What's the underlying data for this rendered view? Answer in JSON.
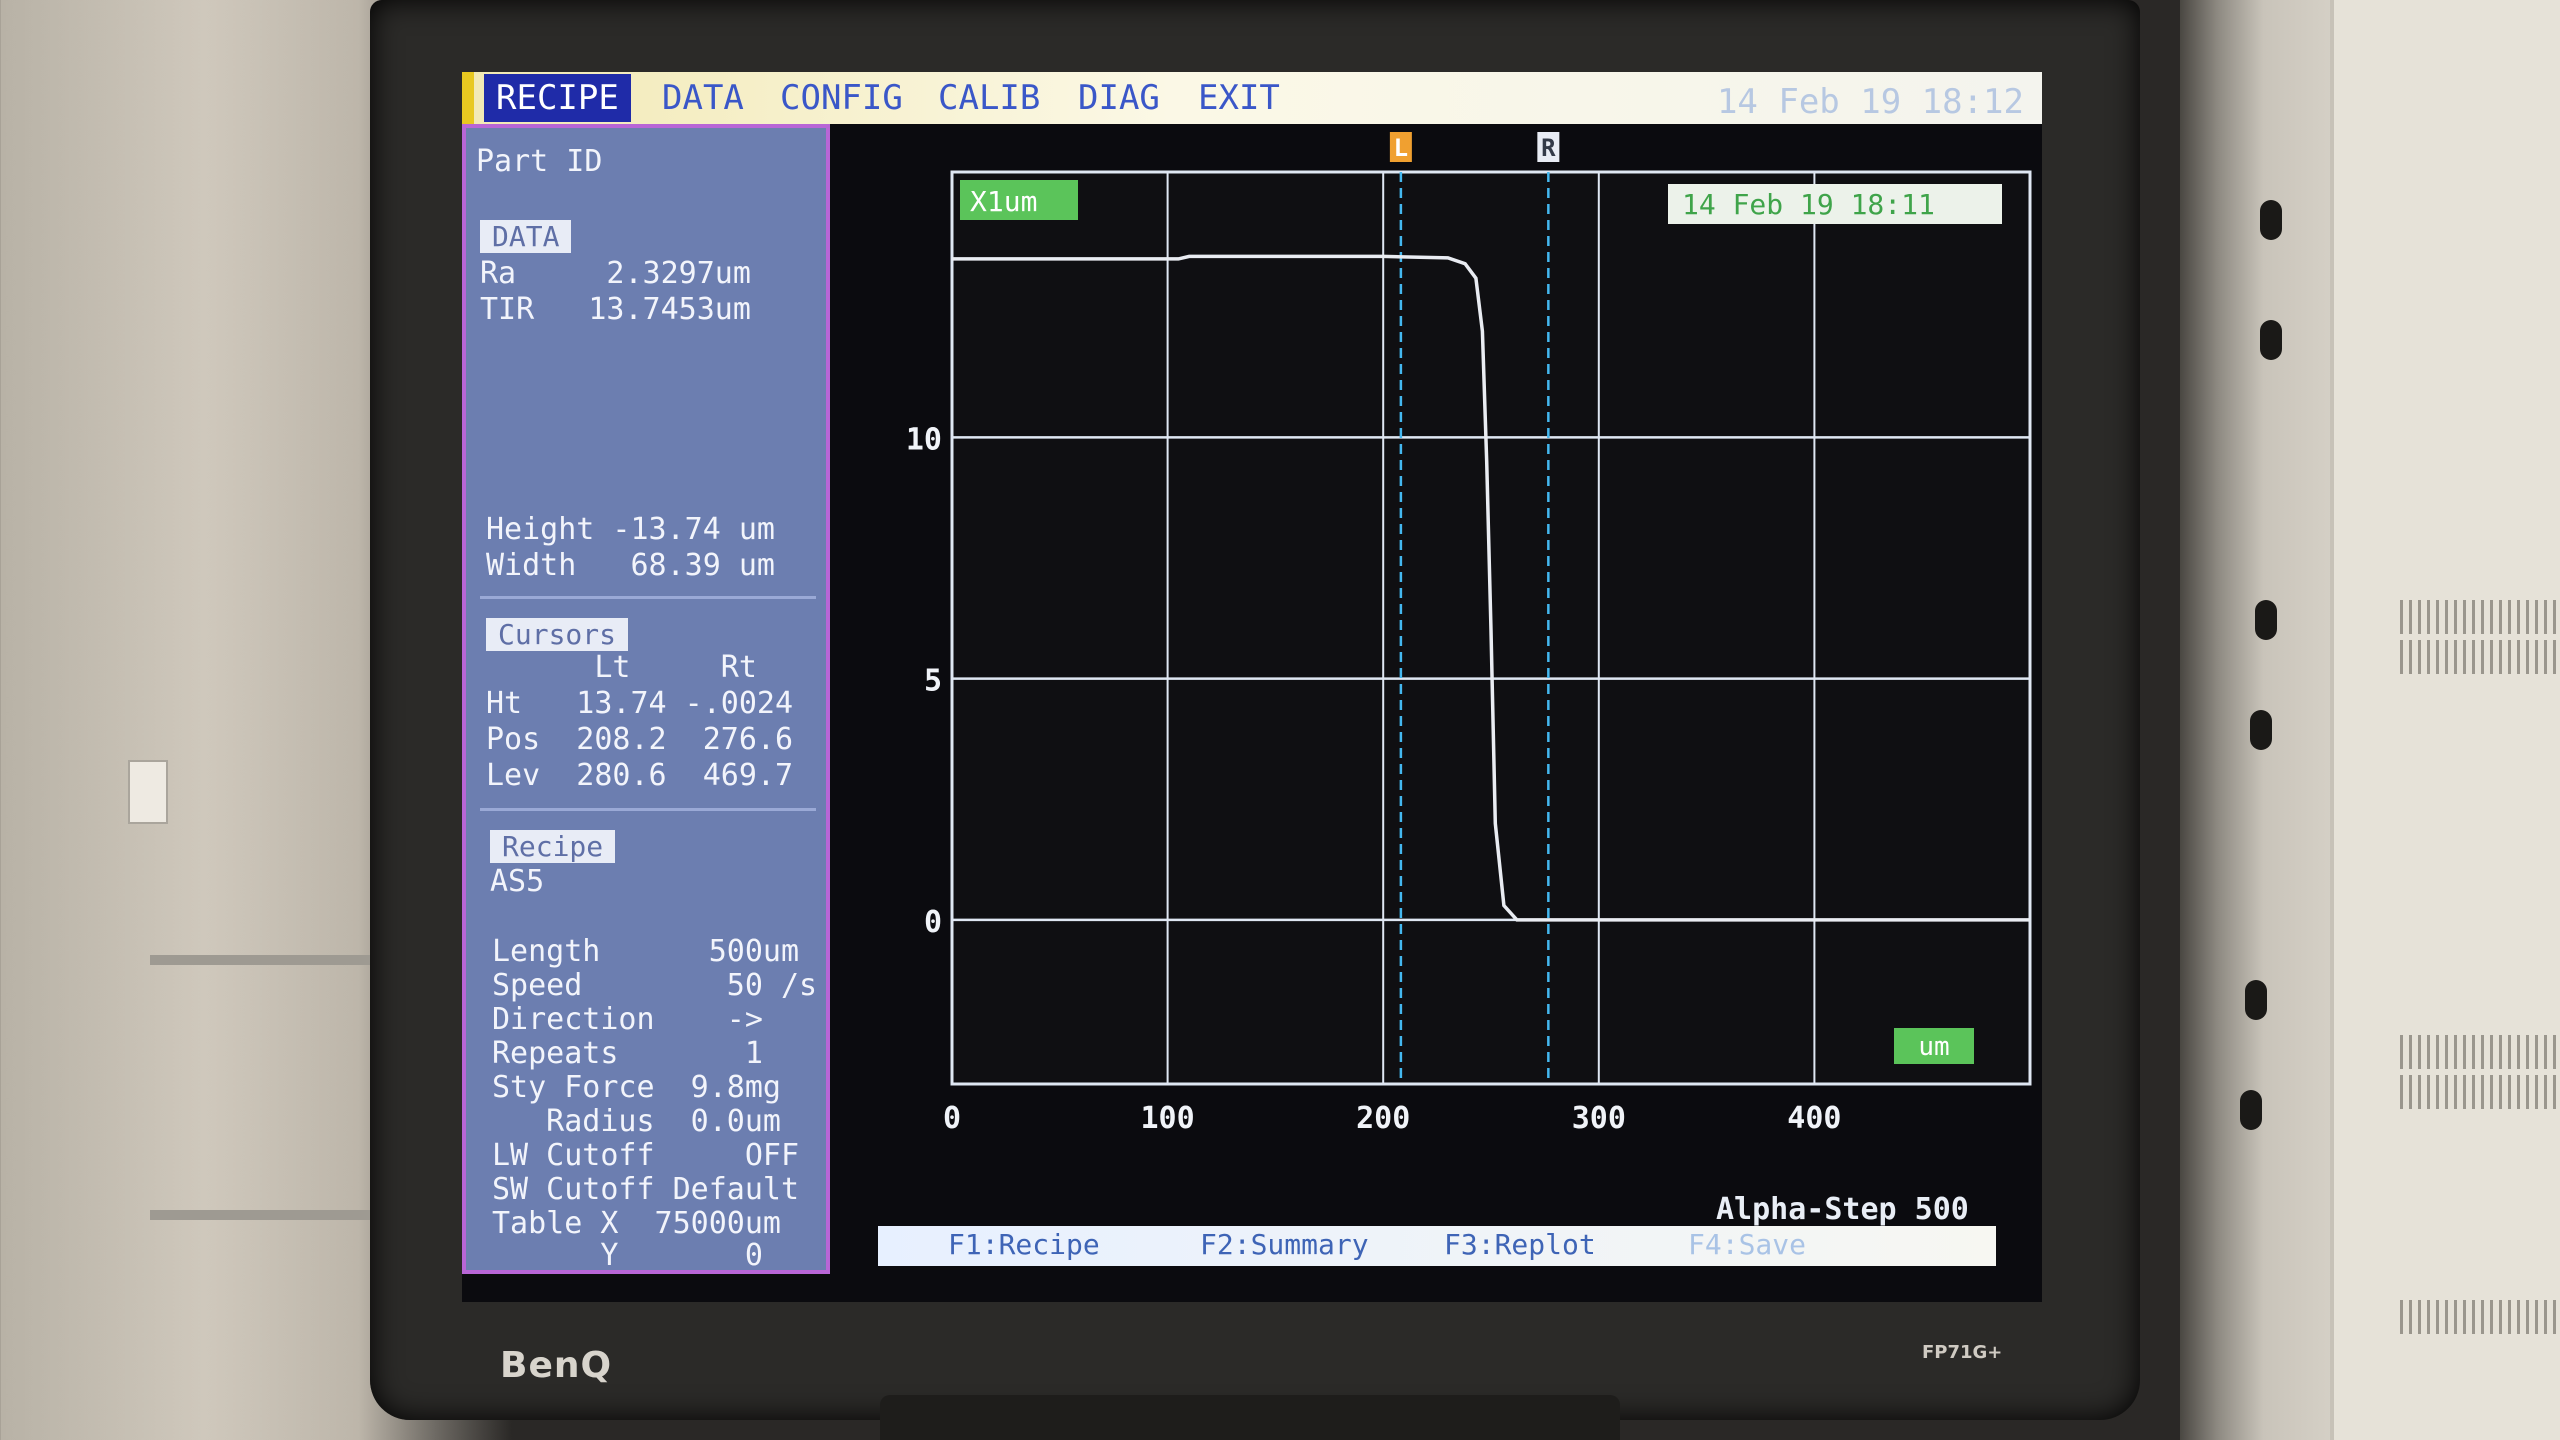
{
  "menu": {
    "items": [
      "RECIPE",
      "DATA",
      "CONFIG",
      "CALIB",
      "DIAG",
      "EXIT"
    ],
    "active": "RECIPE",
    "datetime": "14 Feb 19 18:12"
  },
  "left_panel": {
    "part_id_label": "Part ID",
    "data_tag": "DATA",
    "ra": "Ra     2.3297um",
    "tir": "TIR   13.7453um",
    "height": "Height -13.74 um",
    "width": "Width   68.39 um",
    "cursors_tag": "Cursors",
    "cursor_header": "      Lt     Rt",
    "cursor_ht": "Ht   13.74 -.0024",
    "cursor_pos": "Pos  208.2  276.6",
    "cursor_lev": "Lev  280.6  469.7",
    "recipe_tag": "Recipe",
    "recipe_name": "AS5",
    "length": "Length      500um",
    "speed": "Speed        50 /s",
    "direction": "Direction    ->",
    "repeats": "Repeats       1",
    "sty_force": "Sty Force  9.8mg",
    "radius": "   Radius  0.0um",
    "lw_cutoff": "LW Cutoff     OFF",
    "sw_cutoff": "SW Cutoff Default",
    "table_x": "Table X  75000um",
    "table_y": "      Y       0"
  },
  "plot": {
    "scale_tag": "X1um",
    "date_tag": "14 Feb 19 18:11",
    "unit_tag": "um",
    "cursor_left_label": "L",
    "cursor_right_label": "R",
    "brand": "Alpha-Step 500",
    "colors": {
      "trace": "#e9ecf2",
      "grid": "#dfe7f3",
      "cursor": "#44b8f0",
      "tag_bg": "#5bc45a"
    }
  },
  "fkeys": [
    "F1:Recipe",
    "F2:Summary",
    "F3:Replot",
    "F4:Save"
  ],
  "monitor": {
    "brand": "BenQ",
    "model": "FP71G+"
  },
  "chart_data": {
    "type": "line",
    "title": "",
    "xlabel": "",
    "ylabel": "",
    "xlim": [
      0,
      500
    ],
    "ylim": [
      -3.4,
      15.5
    ],
    "x_ticks": [
      0,
      100,
      200,
      300,
      400
    ],
    "y_ticks": [
      0,
      5,
      10
    ],
    "grid": true,
    "cursors": {
      "left": 208.2,
      "right": 276.6
    },
    "series": [
      {
        "x": [
          0,
          105,
          110,
          200,
          230,
          238,
          243,
          246,
          248,
          250,
          252,
          256,
          262,
          500
        ],
        "y": [
          13.7,
          13.7,
          13.75,
          13.75,
          13.72,
          13.6,
          13.3,
          12.2,
          9.5,
          6.0,
          2.0,
          0.3,
          0.0,
          0.0
        ]
      }
    ]
  }
}
